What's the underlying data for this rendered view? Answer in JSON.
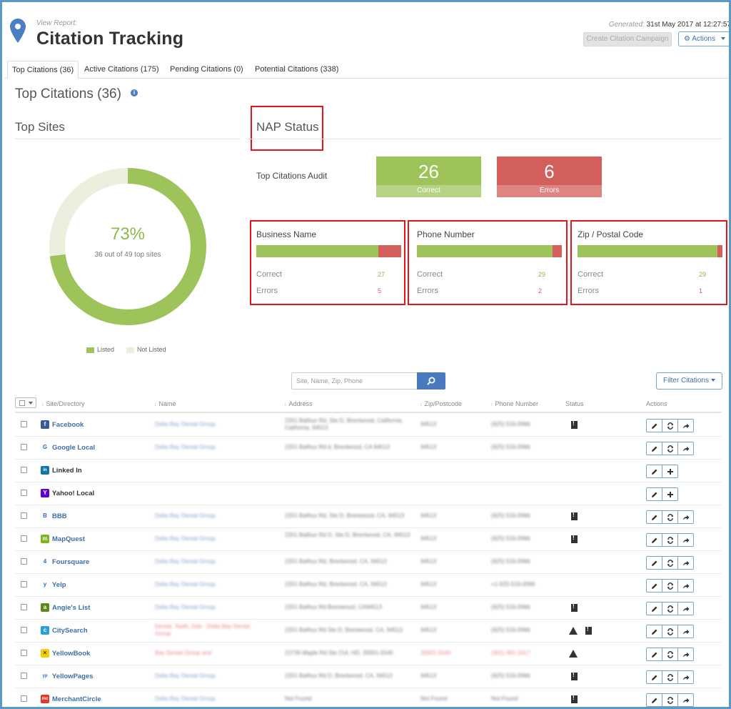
{
  "header": {
    "view_report": "View Report:",
    "title": "Citation Tracking",
    "generated_label": "Generated:",
    "generated_value": "31st May 2017 at 12:27:57",
    "create_campaign": "Create Citation Campaign",
    "actions": "Actions"
  },
  "tabs": [
    {
      "label": "Top Citations (36)",
      "active": true
    },
    {
      "label": "Active Citations (175)",
      "active": false
    },
    {
      "label": "Pending Citations (0)",
      "active": false
    },
    {
      "label": "Potential Citations (338)",
      "active": false
    }
  ],
  "section_title": "Top Citations (36)",
  "top_sites": {
    "title": "Top Sites",
    "percent": "73%",
    "percent_value": 0.73,
    "subtitle": "36 out of 49 top sites",
    "legend_listed": "Listed",
    "legend_not_listed": "Not Listed"
  },
  "nap": {
    "title": "NAP Status",
    "audit_label": "Top Citations Audit",
    "correct_count": "26",
    "correct_label": "Correct",
    "errors_count": "6",
    "errors_label": "Errors",
    "cards": [
      {
        "name": "Business Name",
        "correct_label": "Correct",
        "errors_label": "Errors",
        "correct": "27",
        "errors": "5",
        "correct_frac": 0.844
      },
      {
        "name": "Phone Number",
        "correct_label": "Correct",
        "errors_label": "Errors",
        "correct": "29",
        "errors": "2",
        "correct_frac": 0.935
      },
      {
        "name": "Zip / Postal Code",
        "correct_label": "Correct",
        "errors_label": "Errors",
        "correct": "29",
        "errors": "1",
        "correct_frac": 0.967
      }
    ]
  },
  "search": {
    "placeholder": "Site, Name, Zip, Phone"
  },
  "filter_label": "Filter Citations",
  "table": {
    "headers": {
      "site": "Site/Directory",
      "name": "Name",
      "address": "Address",
      "zip": "Zip/Postcode",
      "phone": "Phone Number",
      "status": "Status",
      "actions": "Actions"
    },
    "rows": [
      {
        "site": "Facebook",
        "icon": "facebook-icon",
        "color": "#3b5998",
        "glyph": "f",
        "name": "Delta Bay Dental Group",
        "address": "2201 Balfour Rd, Ste D, Brentwood, California, California, 94513",
        "zip": "94513",
        "phone": "(925) 516-0066",
        "status": [
          "doc"
        ],
        "acts": [
          "edit",
          "refresh",
          "share"
        ],
        "linked": true
      },
      {
        "site": "Google Local",
        "icon": "google-icon",
        "color": "#ffffff",
        "glyph": "G",
        "name": "Delta Bay Dental Group",
        "address": "2201 Balfour Rd d, Brentwood, CA 94513",
        "zip": "94513",
        "phone": "(925) 516-0066",
        "status": [],
        "acts": [
          "edit",
          "refresh",
          "share"
        ],
        "linked": true
      },
      {
        "site": "Linked In",
        "icon": "linkedin-icon",
        "color": "#0e76a8",
        "glyph": "in",
        "name": "",
        "address": "",
        "zip": "",
        "phone": "",
        "status": [],
        "acts": [
          "edit",
          "add"
        ],
        "linked": false
      },
      {
        "site": "Yahoo! Local",
        "icon": "yahoo-icon",
        "color": "#5f01d1",
        "glyph": "Y",
        "name": "",
        "address": "",
        "zip": "",
        "phone": "",
        "status": [],
        "acts": [
          "edit",
          "add"
        ],
        "linked": false
      },
      {
        "site": "BBB",
        "icon": "bbb-icon",
        "color": "#ffffff",
        "glyph": "B",
        "name": "Delta Bay Dental Group",
        "address": "2201 Balfour Rd, Ste D, Brentwood, CA, 94513",
        "zip": "94513",
        "phone": "(925) 516-0066",
        "status": [
          "doc"
        ],
        "acts": [
          "edit",
          "refresh",
          "share"
        ],
        "linked": true
      },
      {
        "site": "MapQuest",
        "icon": "mapquest-icon",
        "color": "#7ab51d",
        "glyph": "m",
        "name": "Delta Bay Dental Group",
        "address": "2201 Balfour Rd D, Ste D, Brentwood, CA, 94513",
        "zip": "94513",
        "phone": "(925) 516-0066",
        "status": [
          "doc"
        ],
        "acts": [
          "edit",
          "refresh",
          "share"
        ],
        "linked": true
      },
      {
        "site": "Foursquare",
        "icon": "foursquare-icon",
        "color": "#ffffff",
        "glyph": "4",
        "name": "Delta Bay Dental Group",
        "address": "2201 Balfour Rd, Brentwood, CA, 94513",
        "zip": "94513",
        "phone": "(925) 516-0066",
        "status": [],
        "acts": [
          "edit",
          "refresh",
          "share"
        ],
        "linked": true
      },
      {
        "site": "Yelp",
        "icon": "yelp-icon",
        "color": "#ffffff",
        "glyph": "y",
        "name": "Delta Bay Dental Group",
        "address": "2201 Balfour Rd, Brentwood, CA, 94513",
        "zip": "94513",
        "phone": "+1-925-516-0066",
        "status": [],
        "acts": [
          "edit",
          "refresh",
          "share"
        ],
        "linked": true
      },
      {
        "site": "Angie's List",
        "icon": "angies-list-icon",
        "color": "#5a8a1a",
        "glyph": "a",
        "name": "Delta Bay Dental Group",
        "address": "2201 Balfour Rd Brentwood, CA94513",
        "zip": "94513",
        "phone": "(925) 516-0066",
        "status": [
          "doc"
        ],
        "acts": [
          "edit",
          "refresh",
          "share"
        ],
        "linked": true
      },
      {
        "site": "CitySearch",
        "icon": "citysearch-icon",
        "color": "#2a9fd8",
        "glyph": "c",
        "name": "Dental, Teeth, Dds - Delta Bay Dental Group",
        "address": "2201 Balfour Rd Ste D, Brentwood, CA, 94513",
        "zip": "94513",
        "phone": "(925) 516-0066",
        "status": [
          "warn",
          "doc"
        ],
        "acts": [
          "edit",
          "refresh",
          "share"
        ],
        "linked": true,
        "name_err": true
      },
      {
        "site": "YellowBook",
        "icon": "yellowbook-icon",
        "color": "#f5d000",
        "glyph": "✕",
        "name": "Bay Dental Group and",
        "address": "22730 Maple Rd Ste 214, HD, 20001-5540",
        "zip": "20001-5540",
        "phone": "(301) 461-1617",
        "status": [
          "warn"
        ],
        "acts": [
          "edit",
          "refresh",
          "share"
        ],
        "linked": true,
        "name_err": true,
        "zip_err": true,
        "phone_err": true
      },
      {
        "site": "YellowPages",
        "icon": "yellowpages-icon",
        "color": "#ffffff",
        "glyph": "yp",
        "name": "Delta Bay Dental Group",
        "address": "2201 Balfour Rd D, Brentwood, CA, 94513",
        "zip": "94513",
        "phone": "(925) 516-0066",
        "status": [
          "doc"
        ],
        "acts": [
          "edit",
          "refresh",
          "share"
        ],
        "linked": true
      },
      {
        "site": "MerchantCircle",
        "icon": "merchantcircle-icon",
        "color": "#e13a2a",
        "glyph": "mc",
        "name": "Delta Bay Dental Group",
        "address": "Not Found",
        "zip": "Not Found",
        "phone": "Not Found",
        "status": [
          "doc"
        ],
        "acts": [
          "edit",
          "refresh",
          "share"
        ],
        "linked": true
      }
    ]
  },
  "colors": {
    "green": "#9dc35a",
    "red": "#d35f5c",
    "blue": "#3d6fa8",
    "light_green": "#eaf0dd"
  }
}
